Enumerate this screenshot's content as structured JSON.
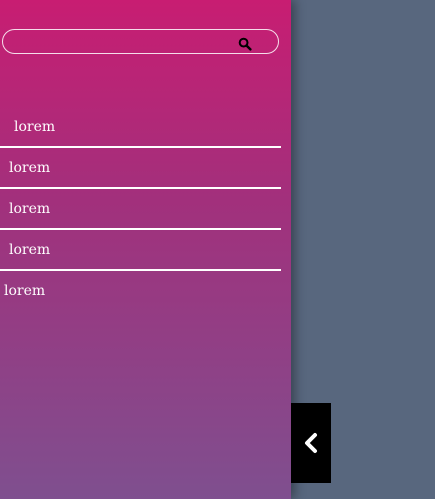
{
  "search": {
    "value": "",
    "placeholder": ""
  },
  "menu": {
    "items": [
      {
        "label": "lorem"
      },
      {
        "label": "lorem"
      },
      {
        "label": "lorem"
      },
      {
        "label": "lorem"
      },
      {
        "label": "lorem"
      }
    ]
  },
  "icons": {
    "search": "search-icon",
    "toggle": "chevron-left-icon"
  },
  "colors": {
    "sidebar_top": "#c81d72",
    "sidebar_bottom": "#7f4f8f",
    "background": "#58677e",
    "toggle_bg": "#000000",
    "text": "#ffffff"
  }
}
